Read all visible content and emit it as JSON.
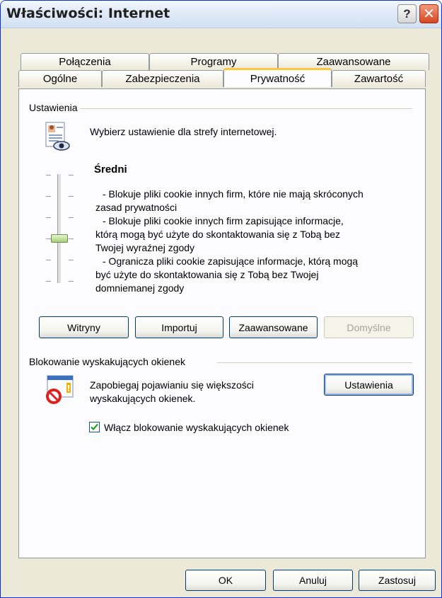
{
  "window": {
    "title": "Właściwości: Internet",
    "help_glyph": "?",
    "close_glyph": "✕"
  },
  "tabs": {
    "row_back": [
      "Połączenia",
      "Programy",
      "Zaawansowane"
    ],
    "row_front": [
      "Ogólne",
      "Zabezpieczenia",
      "Prywatność",
      "Zawartość"
    ],
    "active": "Prywatność"
  },
  "settings": {
    "group_label": "Ustawienia",
    "description": "Wybierz ustawienie dla strefy internetowej.",
    "level_title": "Średni",
    "level_lines": [
      "- Blokuje pliki cookie innych firm, które nie mają skróconych",
      "zasad prywatności",
      "- Blokuje pliki cookie innych firm zapisujące informacje,",
      "którą mogą być użyte do skontaktowania się z Tobą bez",
      "Twojej wyraźnej zgody",
      "- Ogranicza pliki cookie zapisujące informacje, którą mogą",
      "być użyte do skontaktowania się z Tobą bez Twojej",
      "domniemanej zgody"
    ],
    "slider_level": "Średni",
    "buttons": {
      "sites": "Witryny",
      "import": "Importuj",
      "advanced": "Zaawansowane",
      "default": "Domyślne"
    }
  },
  "popup": {
    "group_label": "Blokowanie wyskakujących okienek",
    "description_line1": "Zapobiegaj pojawianiu się większości",
    "description_line2": "wyskakujących okienek.",
    "settings_button": "Ustawienia",
    "checkbox_label": "Włącz blokowanie wyskakujących okienek",
    "checkbox_checked": true
  },
  "footer": {
    "ok": "OK",
    "cancel": "Anuluj",
    "apply": "Zastosuj"
  },
  "colors": {
    "title_border": "#0831d9",
    "close_button": "#d6441f",
    "active_tab_highlight": "#ffc83c",
    "button_border": "#003c74",
    "checkmark": "#21a121"
  }
}
